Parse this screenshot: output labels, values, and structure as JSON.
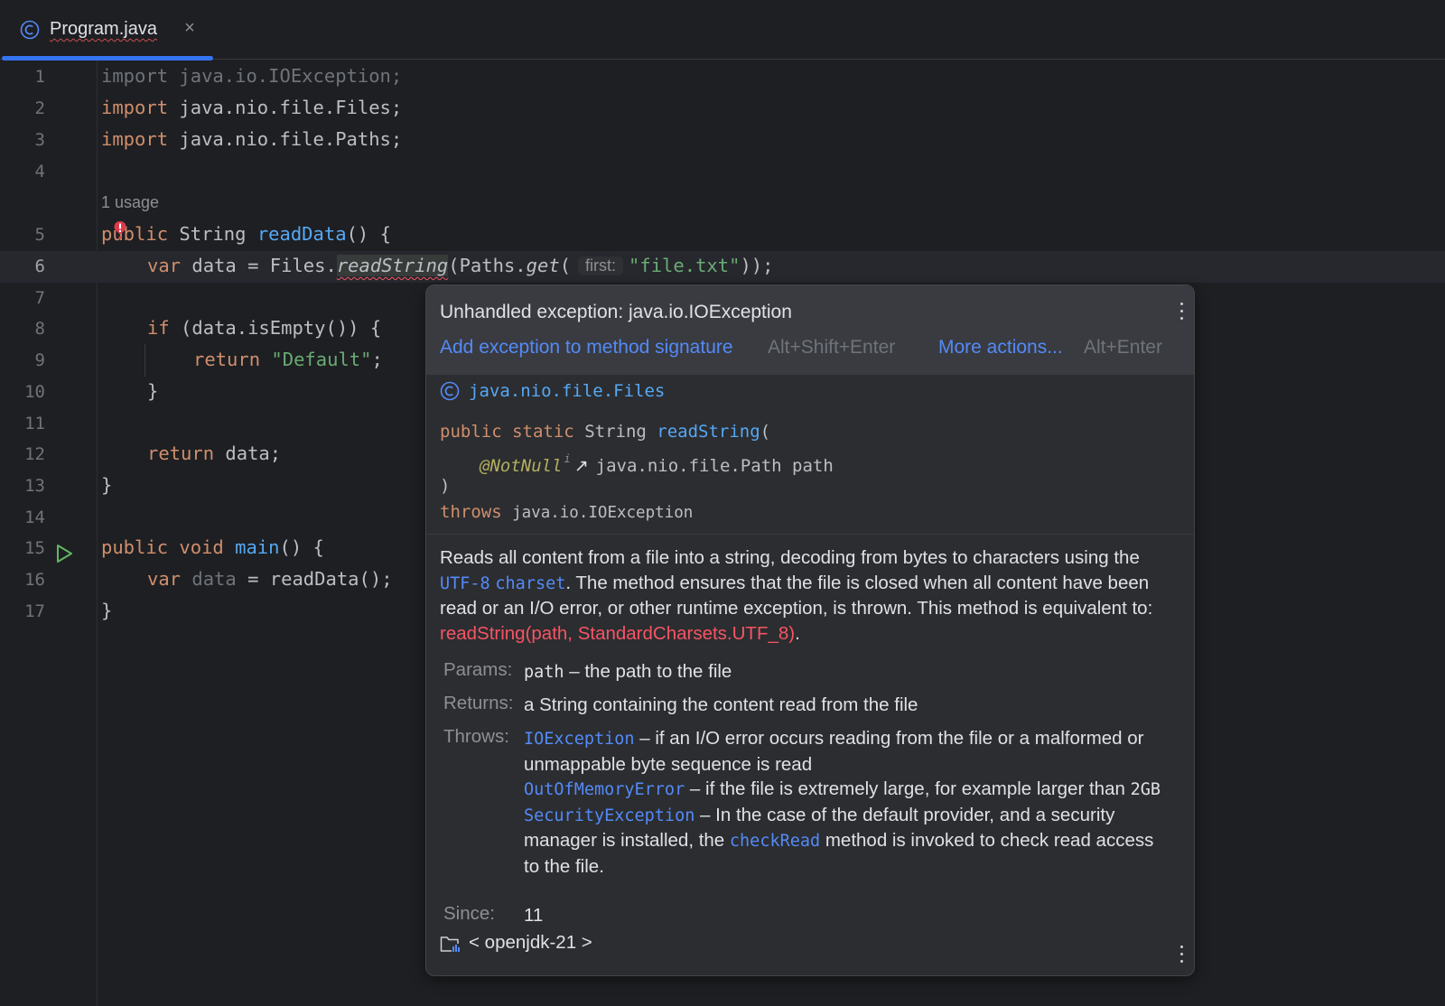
{
  "tab": {
    "filename": "Program.java",
    "close_glyph": "×"
  },
  "editor": {
    "lines": {
      "l1": {
        "num": "1",
        "kw": "import",
        "rest": " java.io.IOException;"
      },
      "l2": {
        "num": "2",
        "kw": "import",
        "rest": " java.nio.file.Files;"
      },
      "l3": {
        "num": "3",
        "kw": "import",
        "rest": " java.nio.file.Paths;"
      },
      "l4": {
        "num": "4"
      },
      "usage": "1 usage",
      "l5": {
        "num": "5",
        "kw": "public",
        "type": " String ",
        "fn": "readData",
        "rest": "() {"
      },
      "l6": {
        "num": "6",
        "kw": "var",
        "a": " data = Files.",
        "method": "readString",
        "b": "(Paths.",
        "get": "get",
        "c": "(",
        "hint": "first:",
        "str": "\"file.txt\"",
        "d": "));"
      },
      "l7": {
        "num": "7"
      },
      "l8": {
        "num": "8",
        "kw": "if",
        "rest": " (data.isEmpty()) {"
      },
      "l9": {
        "num": "9",
        "kw": "return",
        "str": "\"Default\"",
        "rest": ";"
      },
      "l10": {
        "num": "10",
        "text": "}"
      },
      "l11": {
        "num": "11"
      },
      "l12": {
        "num": "12",
        "kw": "return",
        "rest": " data;"
      },
      "l13": {
        "num": "13",
        "text": "}"
      },
      "l14": {
        "num": "14"
      },
      "l15": {
        "num": "15",
        "kw1": "public",
        "kw2": "void",
        "fn": "main",
        "rest": "() {"
      },
      "l16": {
        "num": "16",
        "kw": "var",
        "var": "data",
        "rest": " = readData();"
      },
      "l17": {
        "num": "17",
        "text": "}"
      }
    }
  },
  "popup": {
    "error_title": "Unhandled exception: java.io.IOException",
    "action_primary": "Add exception to method signature",
    "action_primary_kbd": "Alt+Shift+Enter",
    "action_more": "More actions...",
    "action_more_kbd": "Alt+Enter",
    "class_name": "java.nio.file.Files",
    "signature": {
      "kw1": "public",
      "kw2": "static",
      "ret": "String",
      "method": "readString",
      "open": "(",
      "annotation": "@NotNull",
      "annotation_sup": "i",
      "arrow": "↗",
      "param_type": "java.nio.file.Path",
      "param_name": "path",
      "close": ")",
      "throws_kw": "throws",
      "throws_type": "java.io.IOException"
    },
    "description": {
      "p1": "Reads all content from a file into a string, decoding from bytes to characters using the ",
      "link1": "UTF-8",
      "link2": "charset",
      "p2": ". The method ensures that the file is closed when all content have been read or an I/O error, or other runtime exception, is thrown. This method is equivalent to: ",
      "code_link": "readString(path, StandardCharsets.UTF_8)",
      "p3": "."
    },
    "params": {
      "label": "Params:",
      "name": "path",
      "text": " – the path to the file"
    },
    "returns": {
      "label": "Returns:",
      "text": "a String containing the content read from the file"
    },
    "throws": {
      "label": "Throws:",
      "e1": "IOException",
      "t1": " – if an I/O error occurs reading from the file or a malformed or unmappable byte sequence is read",
      "e2": "OutOfMemoryError",
      "t2": " – if the file is extremely large, for example larger than ",
      "t2b": "2GB",
      "e3": "SecurityException",
      "t3": " – In the case of the default provider, and a security manager is installed, the ",
      "e3link": "checkRead",
      "t3b": " method is invoked to check read access to the file."
    },
    "since": {
      "label": "Since:",
      "value": "11"
    },
    "footer": "< openjdk-21 >"
  },
  "colors": {
    "accent": "#3574f0",
    "link": "#548af7",
    "error": "#f75464",
    "keyword": "#cf8e6d",
    "string": "#6aab73",
    "function": "#56a8f5"
  },
  "icons": [
    "class-icon",
    "close-icon",
    "error-icon",
    "run-icon",
    "kebab-menu-icon",
    "library-folder-icon",
    "external-link-icon"
  ]
}
